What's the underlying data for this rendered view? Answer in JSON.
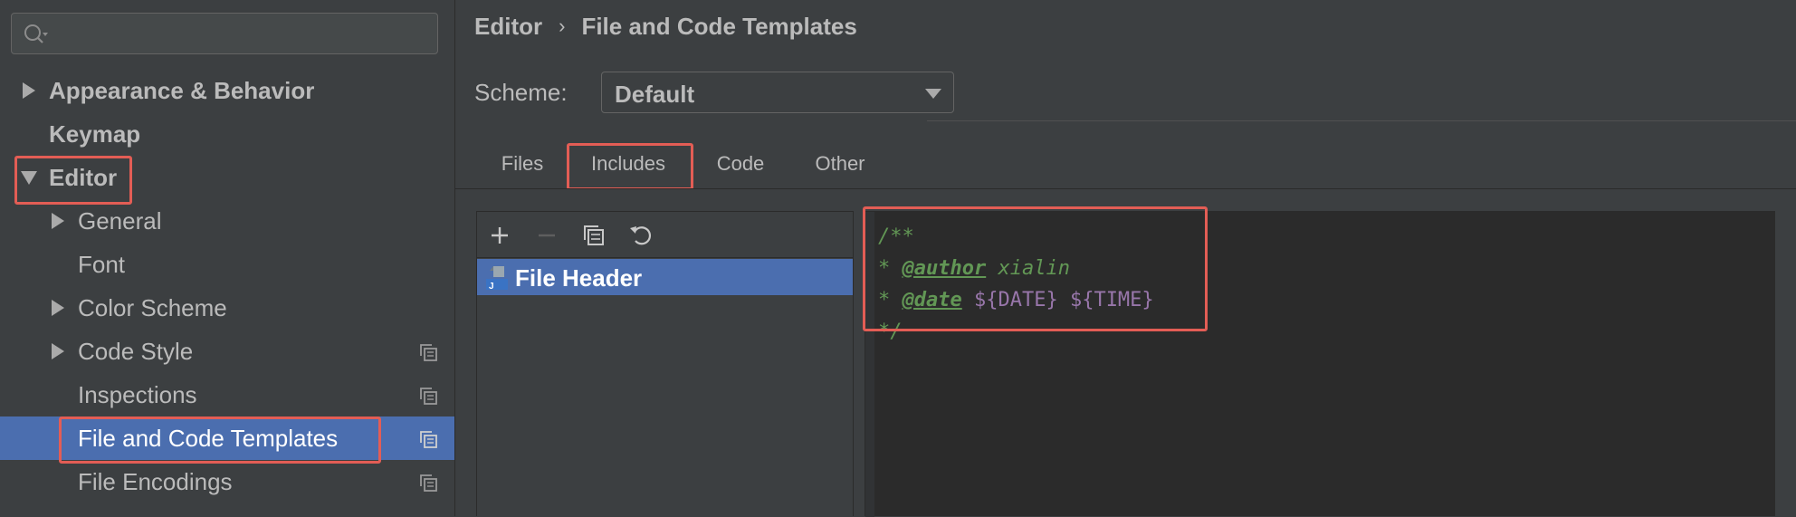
{
  "search": {
    "placeholder": "",
    "value": ""
  },
  "sidebar": {
    "items": [
      {
        "label": "Appearance & Behavior"
      },
      {
        "label": "Keymap"
      },
      {
        "label": "Editor"
      },
      {
        "label": "General"
      },
      {
        "label": "Font"
      },
      {
        "label": "Color Scheme"
      },
      {
        "label": "Code Style"
      },
      {
        "label": "Inspections"
      },
      {
        "label": "File and Code Templates"
      },
      {
        "label": "File Encodings"
      }
    ]
  },
  "breadcrumb": {
    "parent": "Editor",
    "separator": "›",
    "current": "File and Code Templates"
  },
  "scheme": {
    "label": "Scheme:",
    "value": "Default"
  },
  "tabs": [
    {
      "label": "Files"
    },
    {
      "label": "Includes"
    },
    {
      "label": "Code"
    },
    {
      "label": "Other"
    }
  ],
  "templates": {
    "items": [
      {
        "label": "File Header"
      }
    ]
  },
  "editor": {
    "lines": {
      "open": "/**",
      "star": "*",
      "author_tag": "@author",
      "author_value": "xialin",
      "date_tag": "@date",
      "date_var": "${DATE}",
      "time_var": "${TIME}",
      "close": "*/"
    }
  },
  "colors": {
    "selection": "#4b6eaf",
    "highlight": "#e35d55",
    "comment": "#629755",
    "variable": "#9876aa"
  },
  "icons": {
    "search": "search-icon",
    "expand": "triangle-right-icon",
    "collapse": "triangle-down-icon",
    "project_scope": "copy-icon",
    "add": "plus-icon",
    "remove": "minus-icon",
    "copy": "copy-icon",
    "reset": "undo-icon",
    "template_file": "java-file-icon"
  }
}
